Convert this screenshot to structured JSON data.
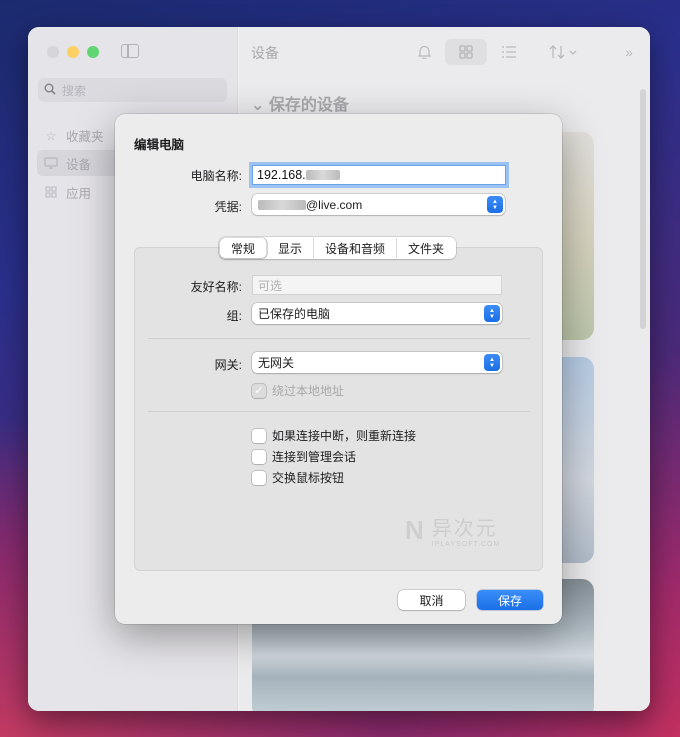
{
  "app": {
    "sidebar": {
      "search_placeholder": "搜索",
      "items": [
        {
          "label": "收藏夹",
          "icon": "star-icon"
        },
        {
          "label": "设备",
          "icon": "monitor-icon"
        },
        {
          "label": "应用",
          "icon": "apps-grid-icon"
        }
      ]
    },
    "main": {
      "title": "设备",
      "section_title": "保存的设备"
    }
  },
  "dialog": {
    "title": "编辑电脑",
    "pc_name_label": "电脑名称:",
    "pc_name_value": "192.168.",
    "credentials_label": "凭据:",
    "credentials_value": "@live.com",
    "tabs": [
      "常规",
      "显示",
      "设备和音频",
      "文件夹"
    ],
    "active_tab": "常规",
    "friendly_name_label": "友好名称:",
    "friendly_name_placeholder": "可选",
    "group_label": "组:",
    "group_value": "已保存的电脑",
    "gateway_label": "网关:",
    "gateway_value": "无网关",
    "bypass_local_label": "绕过本地地址",
    "options": [
      {
        "label": "如果连接中断，则重新连接",
        "checked": false
      },
      {
        "label": "连接到管理会话",
        "checked": false
      },
      {
        "label": "交换鼠标按钮",
        "checked": false
      }
    ],
    "watermark_cn": "异次元",
    "watermark_en": "IPLAYSOFT.COM",
    "cancel_label": "取消",
    "save_label": "保存"
  },
  "colors": {
    "accent": "#1a6fe6",
    "focus_ring": "#9cc2f4"
  }
}
